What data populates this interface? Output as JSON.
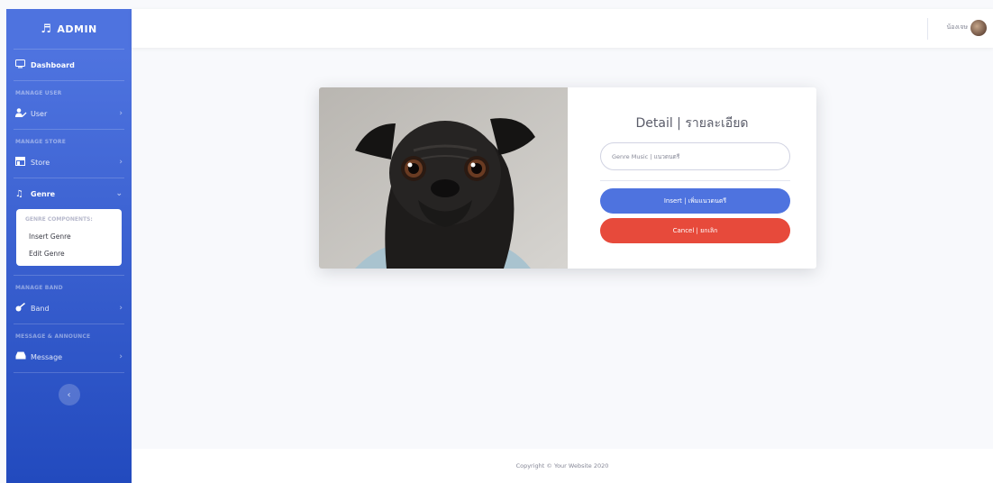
{
  "brand": {
    "title": "ADMIN"
  },
  "sidebar": {
    "dashboard": "Dashboard",
    "headings": {
      "user": "MANAGE USER",
      "store": "MANAGE STORE",
      "band": "MANAGE BAND",
      "message": "MESSAGE & ANNOUNCE"
    },
    "items": {
      "user": "User",
      "store": "Store",
      "genre": "Genre",
      "band": "Band",
      "message": "Message"
    },
    "genre_submenu": {
      "header": "GENRE COMPONENTS:",
      "items": [
        "Insert Genre",
        "Edit Genre"
      ]
    },
    "toggle_icon": "chevron-left-icon"
  },
  "topbar": {
    "user_name": "น้องเจษ"
  },
  "card": {
    "title": "Detail | รายละเอียด",
    "input_placeholder": "Genre Music | แนวดนตรี",
    "insert_label": "Insert | เพิ่มแนวดนตรี",
    "cancel_label": "Cancel | ยกเลิก"
  },
  "footer": {
    "copyright": "Copyright © Your Website 2020"
  },
  "colors": {
    "primary": "#4e73df",
    "danger": "#e74a3b",
    "background": "#f8f9fc"
  }
}
